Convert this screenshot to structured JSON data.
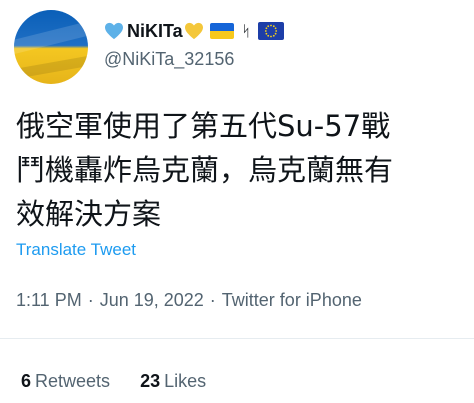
{
  "author": {
    "display_name": "NiKITa",
    "name_suffix_glyph": "ᛋ",
    "handle": "@NiKiTa_32156",
    "avatar_icon": "ukraine-flag-avatar",
    "emojis": [
      "blue-heart-icon",
      "yellow-heart-icon",
      "ukraine-flag-icon",
      "runic-sowilo-glyph",
      "eu-flag-icon"
    ]
  },
  "tweet": {
    "text_lines": [
      "俄空軍使用了第五代Su-57戰",
      "鬥機轟炸烏克蘭，烏克蘭無有",
      "效解決方案"
    ],
    "translate_label": "Translate Tweet"
  },
  "meta": {
    "time": "1:11 PM",
    "date": "Jun 19, 2022",
    "source": "Twitter for iPhone",
    "separator": "·"
  },
  "stats": {
    "retweets_count": "6",
    "retweets_label": "Retweets",
    "likes_count": "23",
    "likes_label": "Likes"
  },
  "colors": {
    "link_blue": "#1d9bf0",
    "secondary_text": "#536471",
    "primary_text": "#0f1419",
    "heart_blue": "#5db1e8",
    "heart_yellow": "#f4c73a",
    "flag_blue": "#1565d8",
    "flag_yellow": "#f7c81c",
    "eu_blue": "#1d3ea8"
  }
}
